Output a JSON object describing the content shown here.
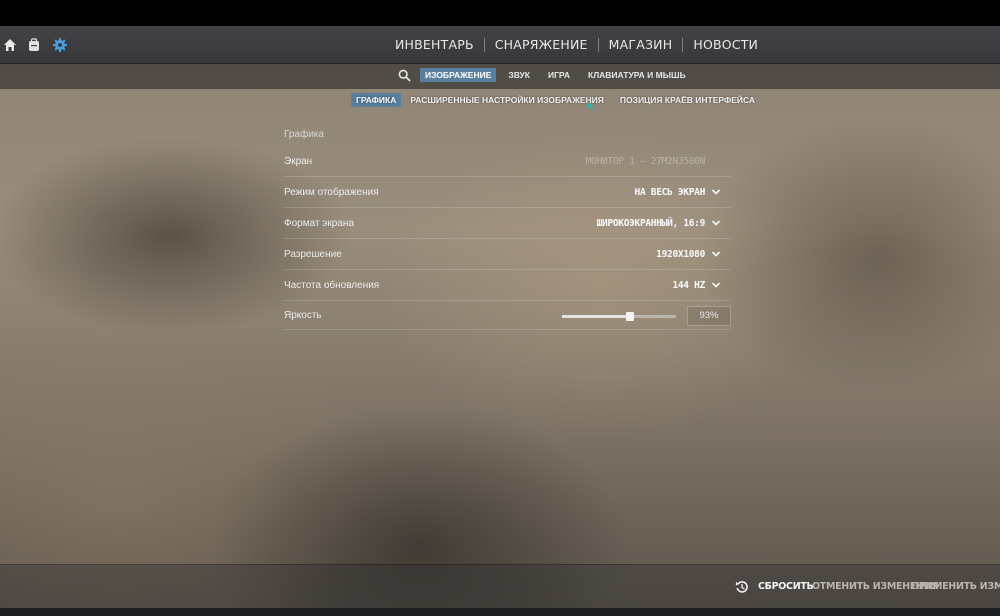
{
  "header": {
    "nav": [
      "ИНВЕНТАРЬ",
      "СНАРЯЖЕНИЕ",
      "МАГАЗИН",
      "НОВОСТИ"
    ]
  },
  "tabs": [
    {
      "label": "ИЗОБРАЖЕНИЕ",
      "active": true
    },
    {
      "label": "ЗВУК",
      "active": false
    },
    {
      "label": "ИГРА",
      "active": false
    },
    {
      "label": "КЛАВИАТУРА И МЫШЬ",
      "active": false
    }
  ],
  "subtabs": [
    {
      "label": "ГРАФИКА",
      "active": true
    },
    {
      "label": "РАСШИРЕННЫЕ НАСТРОЙКИ ИЗОБРАЖЕНИЯ",
      "active": false
    },
    {
      "label": "ПОЗИЦИЯ КРАЁВ ИНТЕРФЕЙСА",
      "active": false
    }
  ],
  "settings": {
    "section_title": "Графика",
    "rows": [
      {
        "label": "Экран",
        "value": "МОНИТОР 1 – 27M2N3500N",
        "disabled": true
      },
      {
        "label": "Режим отображения",
        "value": "НА ВЕСЬ ЭКРАН"
      },
      {
        "label": "Формат экрана",
        "value": "ШИРОКОЭКРАННЫЙ, 16:9"
      },
      {
        "label": "Разрешение",
        "value": "1920X1080"
      },
      {
        "label": "Частота обновления",
        "value": "144 HZ"
      }
    ],
    "brightness": {
      "label": "Яркость",
      "value": "93%",
      "fraction": 0.6
    }
  },
  "footer": {
    "reset_label": "СБРОСИТЬ",
    "cancel_label": "ОТМЕНИТЬ ИЗМЕНЕНИЯ",
    "apply_label": "ПРИМЕНИТЬ ИЗМЕНЕНИЯ"
  },
  "colors": {
    "accent": "#5a7e9e",
    "settings_icon": "#4a9fe0"
  },
  "icons": {
    "home": "home-icon",
    "inventory": "backpack-icon",
    "settings": "gear-icon",
    "search": "search-icon",
    "reset": "reset-icon",
    "chevron": "chevron-down-icon"
  }
}
